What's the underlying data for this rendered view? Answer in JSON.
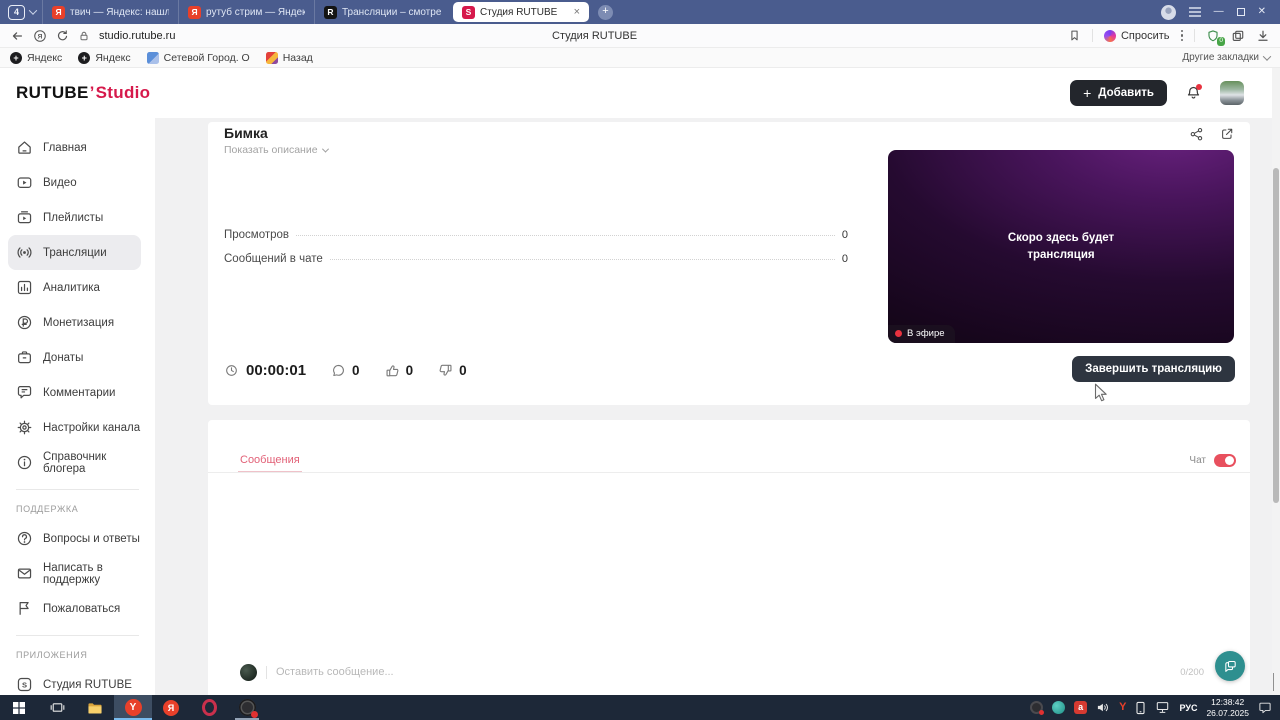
{
  "browser": {
    "tab_counter": "4",
    "tabs": [
      {
        "title": "твич — Яндекс: нашлось"
      },
      {
        "title": "рутуб стрим — Яндекс: н"
      },
      {
        "title": "Трансляции – смотреть в"
      },
      {
        "title": "Студия RUTUBE"
      }
    ],
    "toolbar": {
      "url": "studio.rutube.ru",
      "page_title": "Студия RUTUBE",
      "ask_label": "Спросить",
      "protect_badge": "0"
    },
    "bookmarks_bar": {
      "items": [
        {
          "label": "Яндекс"
        },
        {
          "label": "Яндекс"
        },
        {
          "label": "Сетевой Город. О"
        },
        {
          "label": "Назад"
        }
      ],
      "other_bookmarks": "Другие закладки"
    }
  },
  "studio": {
    "logo": {
      "main": "RUTUBE",
      "mark": "’",
      "sub": "Studio"
    },
    "header": {
      "add_button": "Добавить"
    },
    "sidebar": {
      "items": [
        {
          "label": "Главная"
        },
        {
          "label": "Видео"
        },
        {
          "label": "Плейлисты"
        },
        {
          "label": "Трансляции"
        },
        {
          "label": "Аналитика"
        },
        {
          "label": "Монетизация"
        },
        {
          "label": "Донаты"
        },
        {
          "label": "Комментарии"
        },
        {
          "label": "Настройки канала"
        },
        {
          "label": "Справочник блогера"
        }
      ],
      "support_section": "ПОДДЕРЖКА",
      "support_items": [
        {
          "label": "Вопросы и ответы"
        },
        {
          "label": "Написать в поддержку"
        },
        {
          "label": "Пожаловаться"
        }
      ],
      "apps_section": "ПРИЛОЖЕНИЯ",
      "apps_items": [
        {
          "label": "Студия RUTUBE"
        }
      ]
    },
    "stream": {
      "title": "Бимка",
      "show_description": "Показать описание",
      "stats": [
        {
          "label": "Просмотров",
          "value": "0"
        },
        {
          "label": "Сообщений в чате",
          "value": "0"
        }
      ],
      "timer": "00:00:01",
      "comments_count": "0",
      "likes_count": "0",
      "dislikes_count": "0",
      "preview_text": "Скоро здесь будет трансляция",
      "live_badge": "В эфире",
      "end_button": "Завершить трансляцию"
    },
    "chat": {
      "tab": "Сообщения",
      "toggle_label": "Чат",
      "input_placeholder": "Оставить сообщение...",
      "char_counter": "0/200"
    }
  },
  "taskbar": {
    "tray_language": "РУС",
    "clock_time": "12:38:42",
    "clock_date": "26.07.2025"
  },
  "colors": {
    "accent_red": "#d6194b",
    "toggle_on": "#e8505e",
    "fab_teal": "#2e8f8f",
    "live_dot": "#e8323f",
    "end_button_bg": "#2e3540",
    "tabstrip_bg": "#4a5c8e",
    "taskbar_bg": "#1d2838"
  }
}
